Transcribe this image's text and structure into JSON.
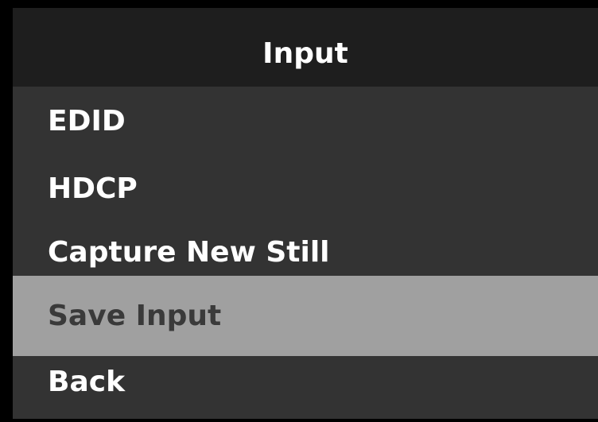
{
  "menu": {
    "title": "Input",
    "items": [
      {
        "label": "EDID",
        "selected": false
      },
      {
        "label": "HDCP",
        "selected": false
      },
      {
        "label": "Capture New Still",
        "selected": false
      },
      {
        "label": "Save Input",
        "selected": true
      },
      {
        "label": "Back",
        "selected": false
      }
    ]
  },
  "colors": {
    "frame": "#000000",
    "header_background": "#1e1e1e",
    "list_background": "#333333",
    "selected_background": "#a0a0a0",
    "text": "#ffffff",
    "selected_text": "#3a3a3a"
  }
}
